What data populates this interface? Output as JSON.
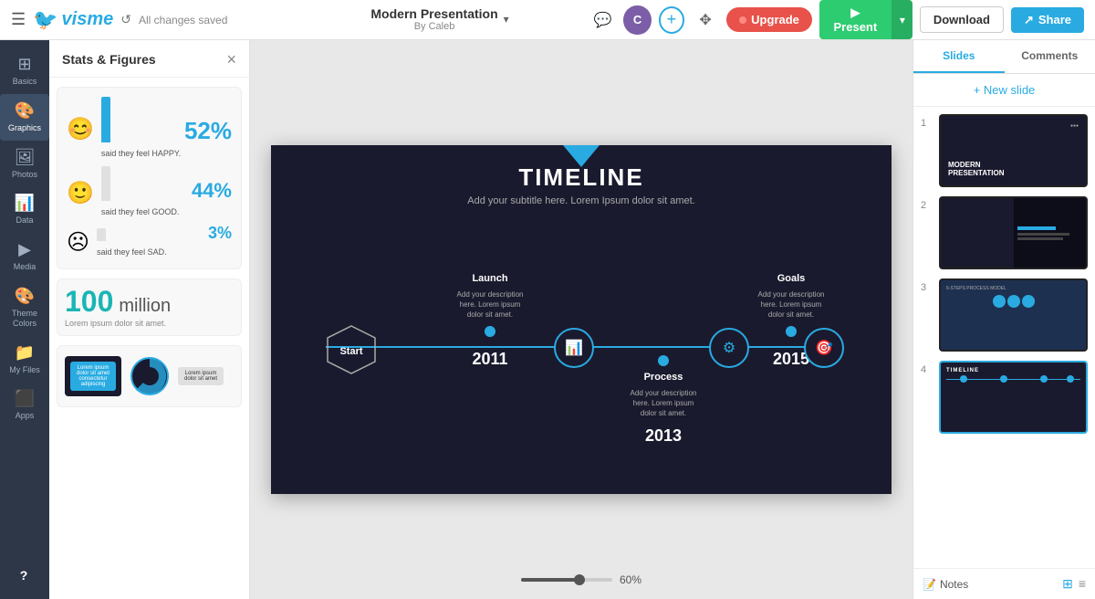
{
  "topbar": {
    "menu_icon": "☰",
    "logo_text": "visme",
    "undo_label": "↺",
    "saved_text": "All changes saved",
    "title": "Modern Presentation",
    "subtitle": "By Caleb",
    "chevron": "▾",
    "comment_icon": "💬",
    "avatar_initials": "C",
    "add_icon": "+",
    "move_icon": "✥",
    "upgrade_label": "Upgrade",
    "present_label": "▶ Present",
    "present_dropdown": "▾",
    "download_label": "Download",
    "share_label": "Share"
  },
  "sidebar": {
    "items": [
      {
        "id": "basics",
        "icon": "⊞",
        "label": "Basics"
      },
      {
        "id": "graphics",
        "icon": "🎨",
        "label": "Graphics"
      },
      {
        "id": "photos",
        "icon": "🖼",
        "label": "Photos"
      },
      {
        "id": "data",
        "icon": "📊",
        "label": "Data"
      },
      {
        "id": "media",
        "icon": "▶",
        "label": "Media"
      },
      {
        "id": "theme-colors",
        "icon": "🎨",
        "label": "Theme Colors"
      },
      {
        "id": "my-files",
        "icon": "📁",
        "label": "My Files"
      },
      {
        "id": "apps",
        "icon": "⬛",
        "label": "Apps"
      }
    ]
  },
  "panel": {
    "title": "Stats & Figures",
    "close_icon": "×",
    "items": [
      {
        "type": "feel-happy",
        "number": "52%",
        "label": "said they feel HAPPY.",
        "icon": "😊"
      },
      {
        "type": "feel-good",
        "number": "44%",
        "label": "said they feel GOOD.",
        "icon": "🙂"
      },
      {
        "type": "feel-sad",
        "number": "3%",
        "label": "said they feel SAD.",
        "icon": "☹"
      },
      {
        "type": "million",
        "number": "100",
        "word": "million",
        "desc": "Lorem ipsum dolor sit amet."
      }
    ]
  },
  "slide": {
    "title": "TIMELINE",
    "subtitle": "Add your subtitle here. Lorem Ipsum dolor sit amet.",
    "nodes": [
      {
        "id": "start",
        "label": "Start",
        "type": "hexagon"
      },
      {
        "id": "launch",
        "label": "Launch",
        "desc": "Add your description here. Lorem ipsum dolor sit amet.",
        "year": "2011"
      },
      {
        "id": "process",
        "label": "Process",
        "desc": "Add your description here. Lorem ipsum dolor sit amet.",
        "year": "2013"
      },
      {
        "id": "goals",
        "label": "Goals",
        "desc": "Add your description here. Lorem ipsum dolor sit amet.",
        "year": "2015"
      }
    ]
  },
  "zoom": {
    "value": "60%"
  },
  "slides_panel": {
    "tabs": [
      {
        "id": "slides",
        "label": "Slides"
      },
      {
        "id": "comments",
        "label": "Comments"
      }
    ],
    "new_slide_label": "+ New slide",
    "slides": [
      {
        "number": "1",
        "type": "dark-title",
        "active": false
      },
      {
        "number": "2",
        "type": "product",
        "active": false
      },
      {
        "number": "3",
        "type": "process",
        "active": false
      },
      {
        "number": "4",
        "type": "timeline",
        "active": true
      }
    ],
    "notes_label": "Notes",
    "view_grid_icon": "⊞",
    "view_list_icon": "≡"
  },
  "help": {
    "label": "?"
  }
}
